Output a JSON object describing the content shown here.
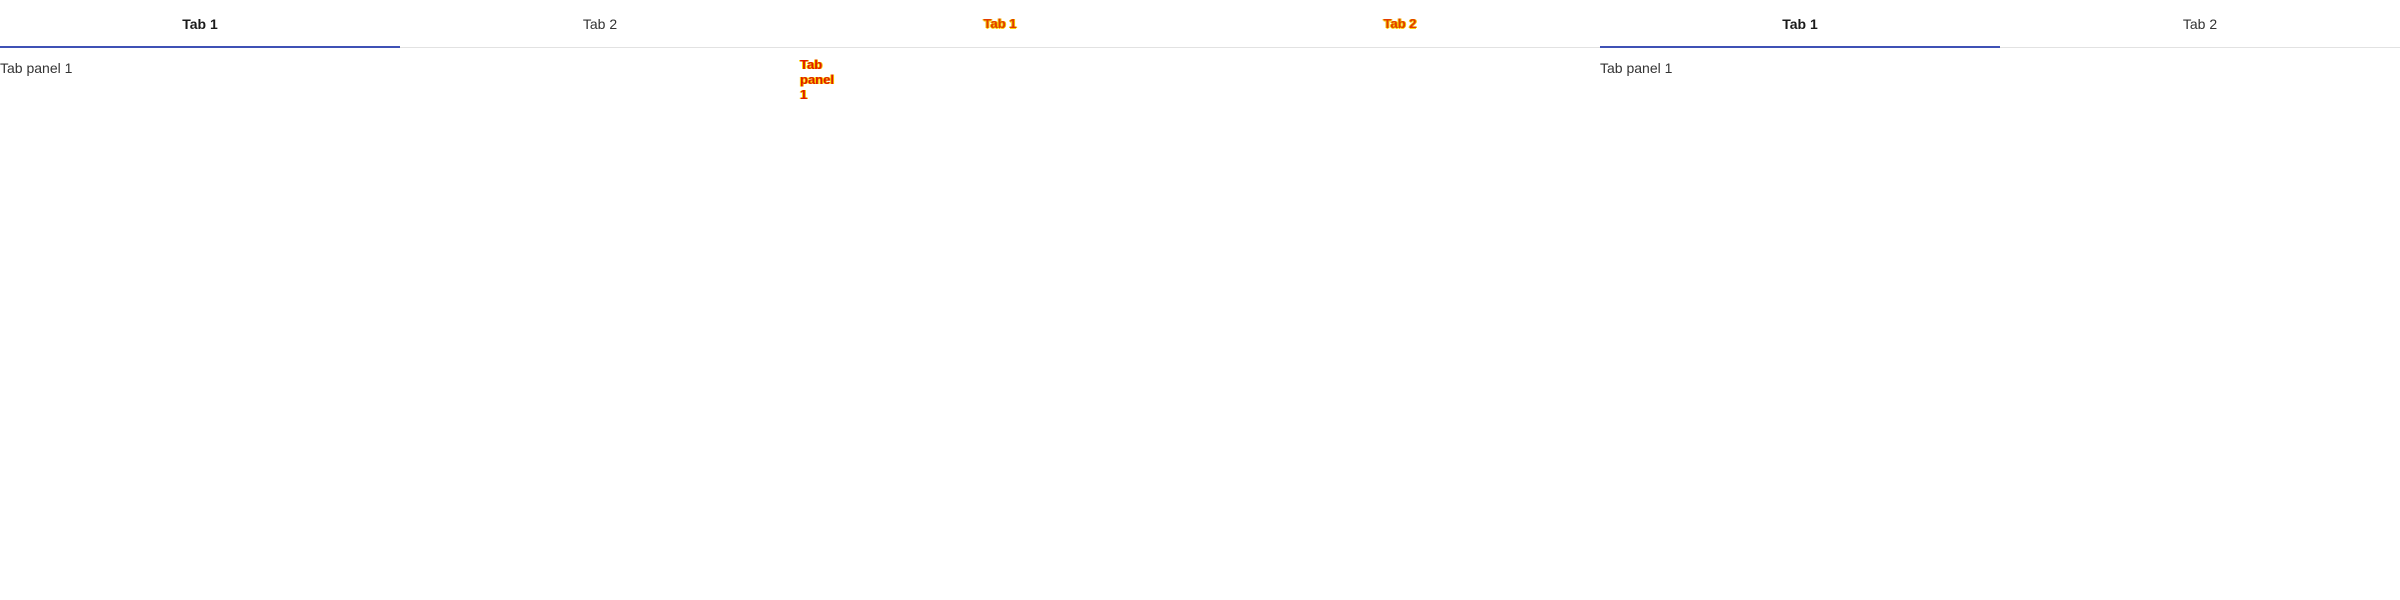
{
  "tabsets": [
    {
      "tabs": [
        {
          "label": "Tab 1",
          "active": true
        },
        {
          "label": "Tab 2",
          "active": false
        }
      ],
      "panel": "Tab panel 1"
    },
    {
      "tabs": [
        {
          "label": "Tab 1",
          "active": false
        },
        {
          "label": "Tab 2",
          "active": false
        }
      ],
      "panel": "Tab panel 1"
    },
    {
      "tabs": [
        {
          "label": "Tab 1",
          "active": true
        },
        {
          "label": "Tab 2",
          "active": false
        }
      ],
      "panel": "Tab panel 1"
    }
  ],
  "colors": {
    "accent": "#3f51b5",
    "glitch_red": "#e23b00",
    "glitch_yellow": "#f2c200",
    "divider": "#e2e2e2"
  }
}
